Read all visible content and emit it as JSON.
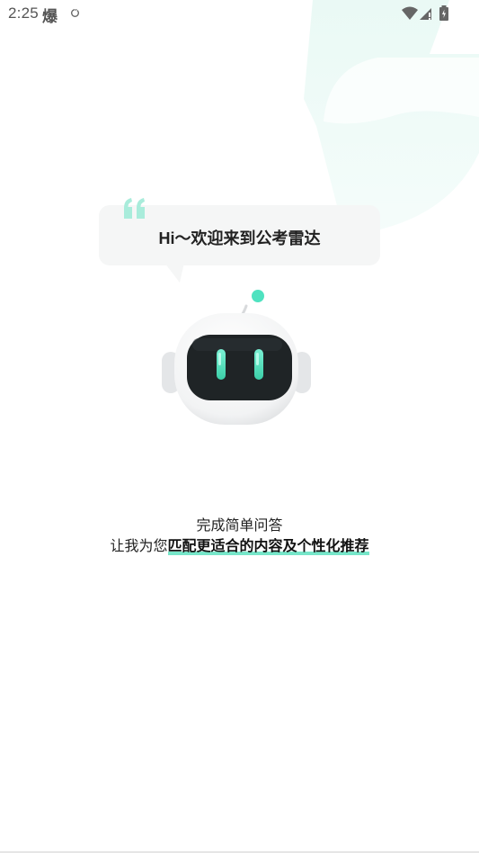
{
  "status_bar": {
    "time": "2:25",
    "app_glyph": "爆",
    "icons": [
      "sync-icon",
      "wifi-icon",
      "signal-icon",
      "battery-icon"
    ]
  },
  "greeting": {
    "text": "Hi～欢迎来到公考雷达"
  },
  "intro": {
    "line1": "完成简单问答",
    "line2_prefix": "让我为您",
    "line2_highlight": "匹配更适合的内容及个性化推荐"
  },
  "colors": {
    "accent": "#49ddb7",
    "accent_light": "#c9f4ea",
    "bubble_bg": "#f5f6f6",
    "robot_screen": "#1f2426"
  }
}
